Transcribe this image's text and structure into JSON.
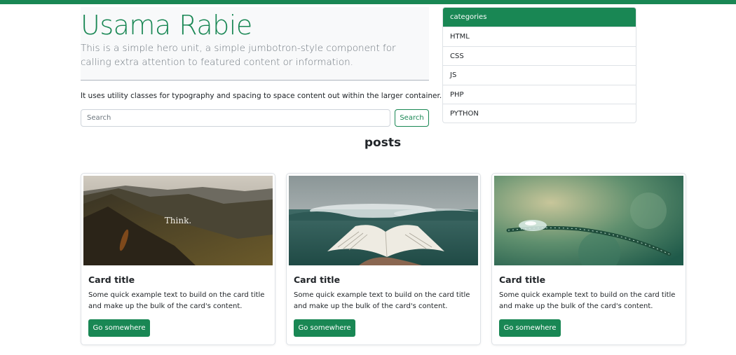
{
  "hero": {
    "title": "Usama Rabie",
    "lead": "This is a simple hero unit, a simple jumbotron-style component for calling extra attention to featured content or information.",
    "text": "It uses utility classes for typography and spacing to space content out within the larger container."
  },
  "search": {
    "placeholder": "Search",
    "button_label": "Search"
  },
  "categories": {
    "header": "categories",
    "items": [
      "HTML",
      "CSS",
      "JS",
      "PHP",
      "PYTHON"
    ]
  },
  "posts": {
    "heading": "posts",
    "cards": [
      {
        "image_text": "Think.",
        "title": "Card title",
        "text": "Some quick example text to build on the card title and make up the bulk of the card's content.",
        "button": "Go somewhere"
      },
      {
        "title": "Card title",
        "text": "Some quick example text to build on the card title and make up the bulk of the card's content.",
        "button": "Go somewhere"
      },
      {
        "title": "Card title",
        "text": "Some quick example text to build on the card title and make up the bulk of the card's content.",
        "button": "Go somewhere"
      }
    ]
  },
  "colors": {
    "accent": "#198754",
    "muted": "#6c757d",
    "border": "#dee2e6"
  }
}
